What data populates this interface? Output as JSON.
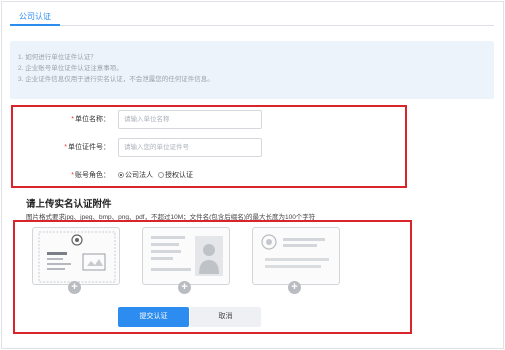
{
  "tab": {
    "label": "公司认证"
  },
  "notice": {
    "lines": [
      "1. 如何进行单位证件认证？",
      "2. 企业账号单位证件认证注意事项。",
      "3. 企业证件信息仅用于进行实名认证，不会泄露您的任何证件信息。"
    ]
  },
  "form": {
    "unit_name": {
      "label": "单位名称：",
      "placeholder": "请输入单位名称",
      "value": ""
    },
    "unit_cert_no": {
      "label": "单位证件号：",
      "placeholder": "请输入您的单位证件号",
      "value": ""
    },
    "account_role": {
      "label": "账号角色：",
      "options": [
        "公司法人",
        "授权认证"
      ],
      "selected": "公司法人"
    }
  },
  "upload": {
    "title": "请上传实名认证附件",
    "hint": "图片格式要求jpg、jpeg、bmp、png、pdf，不超过10M；文件名(包含后缀名)的最大长度为100个字符",
    "cards": [
      {
        "icon": "business-license-icon",
        "add": "+"
      },
      {
        "icon": "id-card-portrait-icon",
        "add": "+"
      },
      {
        "icon": "id-card-emblem-icon",
        "add": "+"
      }
    ]
  },
  "actions": {
    "submit": "提交认证",
    "cancel": "取消"
  },
  "colors": {
    "accent": "#2d8cf0",
    "highlight_border": "#d9242b",
    "notice_bg": "#edf3fb"
  }
}
